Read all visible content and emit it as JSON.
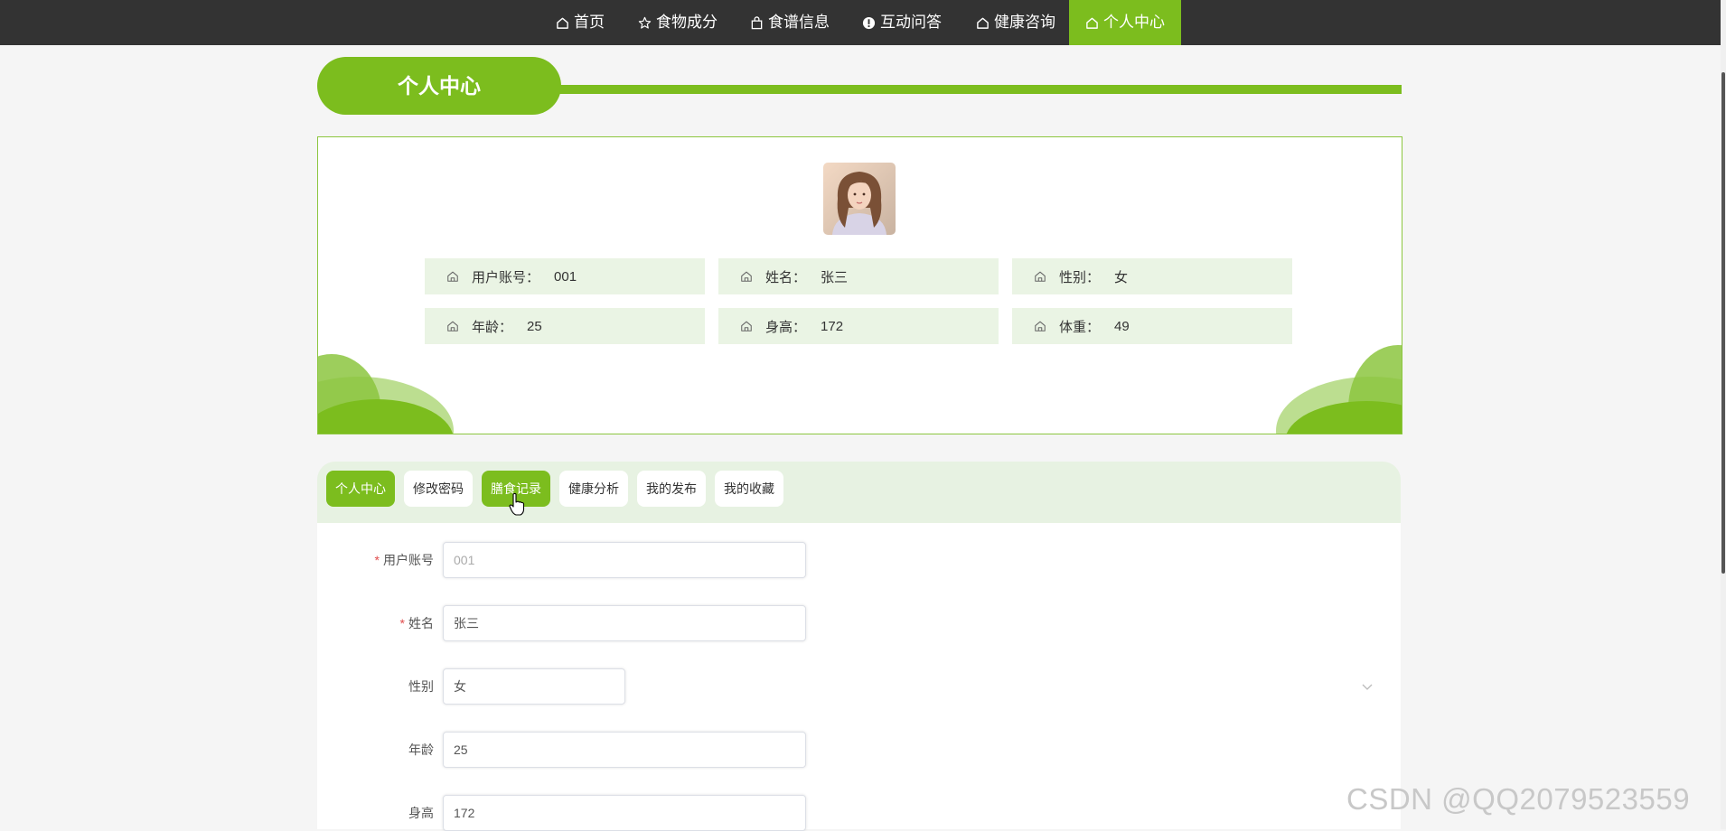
{
  "nav": {
    "items": [
      {
        "label": "首页",
        "icon": "home-icon"
      },
      {
        "label": "食物成分",
        "icon": "star-icon"
      },
      {
        "label": "食谱信息",
        "icon": "bag-icon"
      },
      {
        "label": "互动问答",
        "icon": "alert-circle-icon"
      },
      {
        "label": "健康咨询",
        "icon": "home-icon"
      },
      {
        "label": "个人中心",
        "icon": "home-icon"
      }
    ],
    "active": "个人中心"
  },
  "section_title": "个人中心",
  "profile": {
    "fields": [
      {
        "label": "用户账号：",
        "value": "001"
      },
      {
        "label": "姓名：",
        "value": "张三"
      },
      {
        "label": "性别：",
        "value": "女"
      },
      {
        "label": "年龄：",
        "value": "25"
      },
      {
        "label": "身高：",
        "value": "172"
      },
      {
        "label": "体重：",
        "value": "49"
      }
    ]
  },
  "tabs": [
    {
      "label": "个人中心",
      "active": true
    },
    {
      "label": "修改密码",
      "active": false
    },
    {
      "label": "膳食记录",
      "active": false,
      "hovered": true
    },
    {
      "label": "健康分析",
      "active": false
    },
    {
      "label": "我的发布",
      "active": false
    },
    {
      "label": "我的收藏",
      "active": false
    }
  ],
  "form": {
    "account": {
      "label": "用户账号",
      "required": "*",
      "placeholder": "001"
    },
    "name": {
      "label": "姓名",
      "required": "*",
      "value": "张三"
    },
    "gender": {
      "label": "性别",
      "value": "女"
    },
    "age": {
      "label": "年龄",
      "value": "25"
    },
    "height": {
      "label": "身高",
      "value": "172"
    }
  },
  "watermark": "CSDN @QQ2079523559",
  "colors": {
    "accent": "#7cbd1e",
    "nav_bg": "#333333",
    "info_bg": "#eaf4e4",
    "required": "#e04b4b"
  }
}
